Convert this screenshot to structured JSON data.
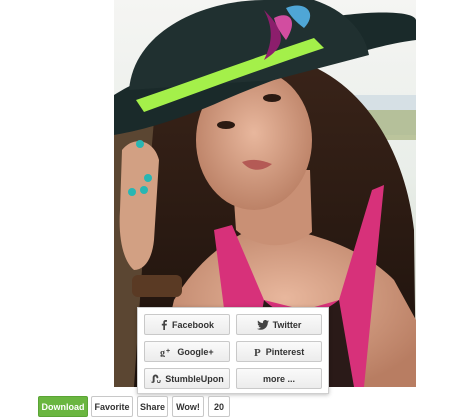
{
  "share_menu": {
    "facebook": "Facebook",
    "twitter": "Twitter",
    "google_plus": "Google+",
    "pinterest": "Pinterest",
    "stumbleupon": "StumbleUpon",
    "more": "more ..."
  },
  "actions": {
    "download": "Download",
    "favorite": "Favorite",
    "share": "Share",
    "wow": "Wow!",
    "count": "20"
  },
  "colors": {
    "download_green": "#6ab640",
    "hat_band": "#a4f04a",
    "top_pink": "#d7317a"
  },
  "icons": [
    "facebook-icon",
    "twitter-icon",
    "google-plus-icon",
    "pinterest-icon",
    "stumbleupon-icon"
  ]
}
